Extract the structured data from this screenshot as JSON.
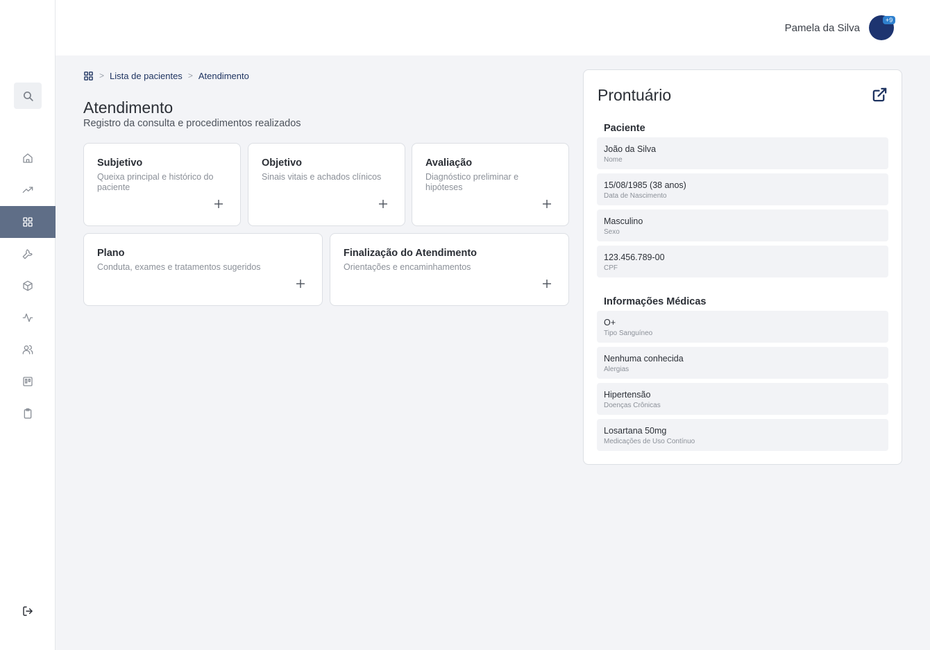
{
  "header": {
    "user_name": "Pamela da Silva",
    "notification_badge": "+9"
  },
  "sidebar": {
    "items": [
      {
        "name": "home",
        "icon": "home-icon"
      },
      {
        "name": "trending",
        "icon": "trending-up-icon"
      },
      {
        "name": "dashboard",
        "icon": "grid-icon",
        "active": true
      },
      {
        "name": "tools",
        "icon": "wrench-icon"
      },
      {
        "name": "package",
        "icon": "box-icon"
      },
      {
        "name": "activity",
        "icon": "activity-icon"
      },
      {
        "name": "users",
        "icon": "users-icon"
      },
      {
        "name": "board",
        "icon": "board-icon"
      },
      {
        "name": "clipboard",
        "icon": "clipboard-icon"
      }
    ],
    "logout_icon": "logout-icon"
  },
  "breadcrumb": {
    "home_icon": "grid-icon",
    "items": [
      "Lista de pacientes",
      "Atendimento"
    ],
    "separator": ">"
  },
  "page": {
    "title": "Atendimento",
    "subtitle": "Registro da consulta e procedimentos realizados"
  },
  "cards": [
    {
      "title": "Subjetivo",
      "description": "Queixa principal e histórico do paciente"
    },
    {
      "title": "Objetivo",
      "description": "Sinais vitais e achados clínicos"
    },
    {
      "title": "Avaliação",
      "description": "Diagnóstico preliminar e hipóteses"
    },
    {
      "title": "Plano",
      "description": "Conduta, exames e tratamentos sugeridos"
    },
    {
      "title": "Finalização do Atendimento",
      "description": "Orientações e encaminhamentos"
    }
  ],
  "prontuario": {
    "title": "Prontuário",
    "sections": [
      {
        "title": "Paciente",
        "fields": [
          {
            "value": "João da Silva",
            "label": "Nome"
          },
          {
            "value": "15/08/1985 (38 anos)",
            "label": "Data de Nascimento"
          },
          {
            "value": "Masculino",
            "label": "Sexo"
          },
          {
            "value": "123.456.789-00",
            "label": "CPF"
          }
        ]
      },
      {
        "title": "Informações Médicas",
        "fields": [
          {
            "value": "O+",
            "label": "Tipo Sanguíneo"
          },
          {
            "value": "Nenhuma conhecida",
            "label": "Alergias"
          },
          {
            "value": "Hipertensão",
            "label": "Doenças Crônicas"
          },
          {
            "value": "Losartana 50mg",
            "label": "Medicações de Uso Contínuo"
          }
        ]
      }
    ]
  },
  "colors": {
    "sidebar_active": "#5f6e87",
    "avatar": "#1d3470",
    "badge": "#2f80ce",
    "breadcrumb": "#1f3461"
  }
}
